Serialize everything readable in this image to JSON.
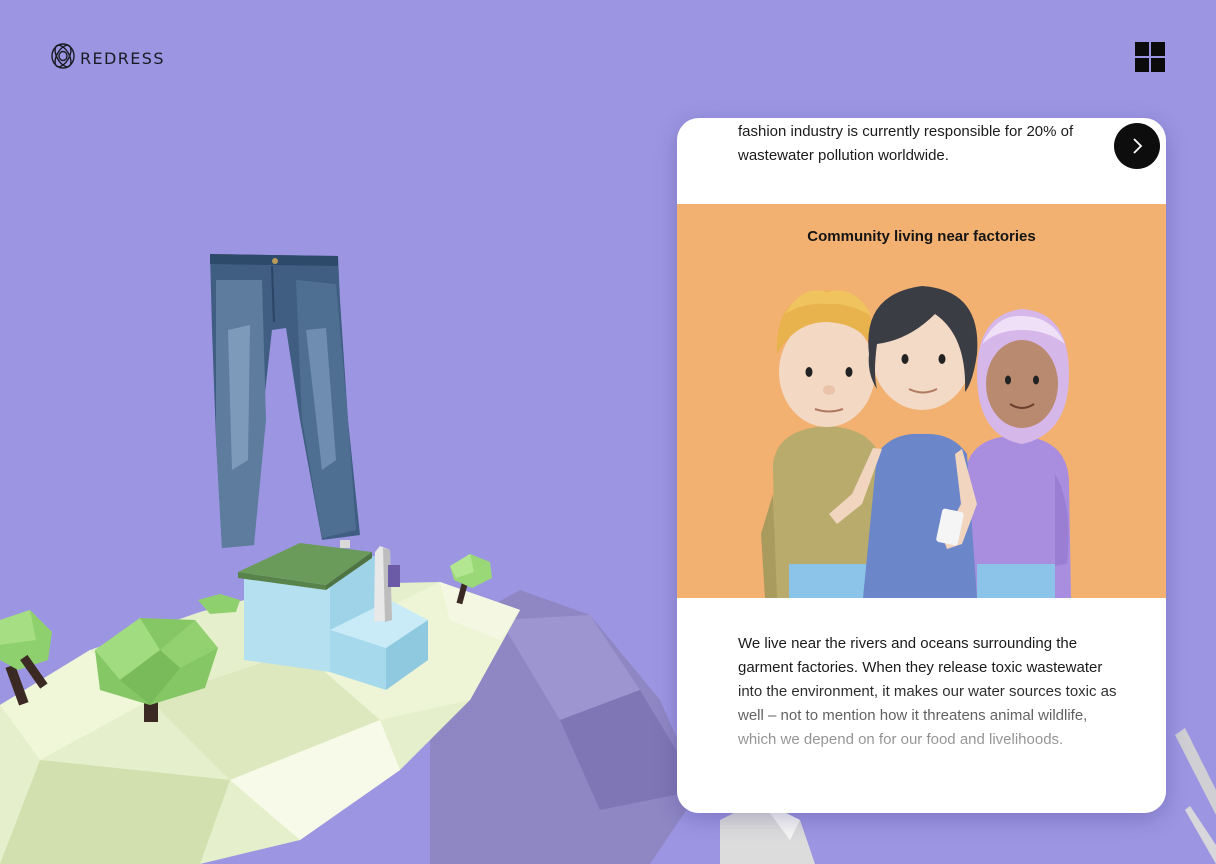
{
  "brand": {
    "name": "REDRESS",
    "logo_icon": "knot-icon"
  },
  "header": {
    "menu_icon": "grid-menu-icon"
  },
  "card": {
    "intro_text": "fashion industry is currently responsible for 20% of wastewater pollution worldwide.",
    "next_icon": "chevron-right-icon",
    "illustration_title": "Community living near factories",
    "body_text": "We live near the rivers and oceans surrounding the garment factories. When they release toxic wastewater into the environment, it makes our water sources toxic as well – not to mention how it threatens animal wildlife, which we depend on for our food and livelihoods."
  },
  "colors": {
    "background": "#9c96e2",
    "card_bg": "#ffffff",
    "illustration_bg": "#f2b071",
    "accent_dark": "#0d0d0d"
  }
}
